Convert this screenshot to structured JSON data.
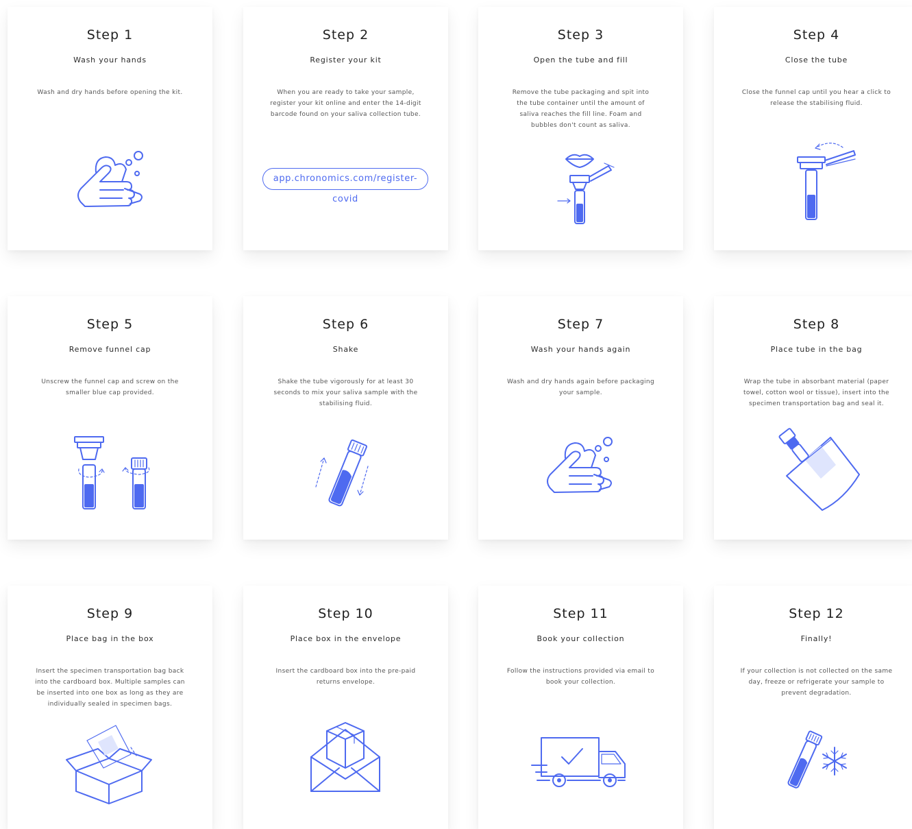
{
  "steps": [
    {
      "title": "Step 1",
      "subtitle": "Wash your hands",
      "desc": "Wash and dry hands before opening the kit.",
      "icon": "hands-washing-icon"
    },
    {
      "title": "Step 2",
      "subtitle": "Register your kit",
      "desc": "When you are ready to take your sample,\nregister your kit online and enter the 14-digit\nbarcode found on your saliva collection tube.",
      "icon": "register-link",
      "link": "app.chronomics.com/register-covid"
    },
    {
      "title": "Step 3",
      "subtitle": "Open the tube and fill",
      "desc": "Remove the tube packaging and spit into\nthe tube container until the amount of\nsaliva reaches the fill line. Foam and\nbubbles don't count as saliva.",
      "icon": "spit-tube-icon"
    },
    {
      "title": "Step 4",
      "subtitle": "Close the tube",
      "desc": "Close the funnel cap until you hear a click to\nrelease the stabilising fluid.",
      "icon": "close-tube-icon"
    },
    {
      "title": "Step 5",
      "subtitle": "Remove funnel cap",
      "desc": "Unscrew the funnel cap and screw on the\nsmaller blue cap provided.",
      "icon": "swap-cap-icon"
    },
    {
      "title": "Step 6",
      "subtitle": "Shake",
      "desc": "Shake the tube vigorously for at least 30\nseconds to mix your saliva sample with the\nstabilising fluid.",
      "icon": "shake-tube-icon"
    },
    {
      "title": "Step 7",
      "subtitle": "Wash your hands again",
      "desc": "Wash and dry hands again before packaging\nyour sample.",
      "icon": "hands-washing-icon"
    },
    {
      "title": "Step 8",
      "subtitle": "Place tube in the bag",
      "desc": "Wrap the tube in absorbant material (paper\ntowel, cotton wool or tissue), insert into the\nspecimen transportation bag and seal it.",
      "icon": "tube-bag-icon"
    },
    {
      "title": "Step 9",
      "subtitle": "Place bag in the box",
      "desc": "Insert the specimen transportation bag back\ninto the cardboard box. Multiple samples can\nbe inserted into one box as long as they are\nindividually sealed in specimen bags.",
      "icon": "bag-box-icon"
    },
    {
      "title": "Step 10",
      "subtitle": "Place box in the envelope",
      "desc": "Insert the cardboard box into the pre-paid\nreturns envelope.",
      "icon": "box-envelope-icon"
    },
    {
      "title": "Step 11",
      "subtitle": "Book your collection",
      "desc": "Follow the instructions provided via email to\nbook your collection.",
      "icon": "delivery-truck-icon"
    },
    {
      "title": "Step 12",
      "subtitle": "Finally!",
      "desc": "If your collection is not collected on the same\nday, freeze or refrigerate your sample to\nprevent degradation.",
      "icon": "freeze-tube-icon"
    }
  ],
  "colors": {
    "accent": "#4e6af0"
  }
}
